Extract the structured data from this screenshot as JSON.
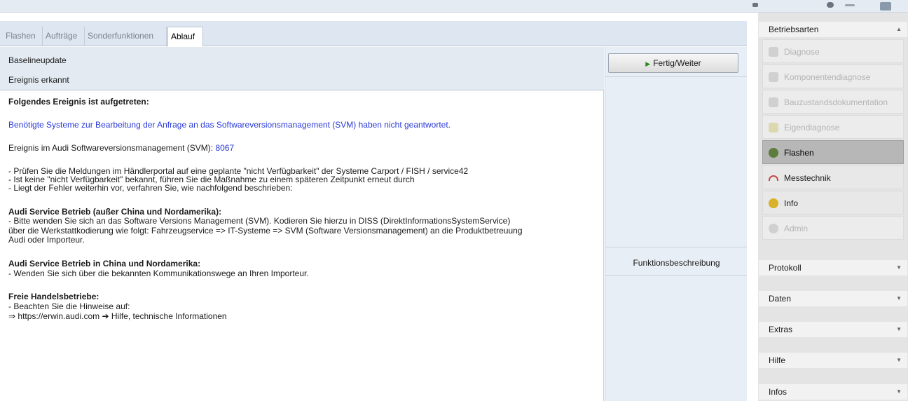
{
  "tabs": [
    {
      "label": "Flashen"
    },
    {
      "label": "Aufträge"
    },
    {
      "label": "Sonderfunktionen"
    },
    {
      "label": "Ablauf"
    }
  ],
  "header": {
    "line1": "Baselineupdate",
    "line2": "Ereignis erkannt"
  },
  "content": {
    "heading": "Folgendes Ereignis ist aufgetreten:",
    "blue_notice": "Benötigte Systeme zur Bearbeitung der Anfrage an das Softwareversionsmanagement (SVM) haben nicht geantwortet.",
    "event_prefix": "Ereignis im Audi Softwareversionsmanagement (SVM): ",
    "event_code": "8067",
    "checks": [
      "- Prüfen Sie die Meldungen im Händlerportal auf eine geplante \"nicht Verfügbarkeit\" der Systeme Carport / FISH / service42",
      "- Ist keine \"nicht Verfügbarkeit\" bekannt, führen Sie die Maßnahme zu einem späteren Zeitpunkt erneut durch",
      "- Liegt der Fehler weiterhin vor, verfahren Sie, wie nachfolgend beschrieben:"
    ],
    "section1_title": "Audi Service Betrieb (außer China und Nordamerika):",
    "section1_lines": [
      "- Bitte wenden Sie sich an das Software Versions Management (SVM). Kodieren Sie hierzu in DISS (DirektInformationsSystemService)",
      "über die Werkstattkodierung wie folgt: Fahrzeugservice => IT-Systeme => SVM (Software Versionsmanagement) an die Produktbetreuung",
      "Audi oder Importeur."
    ],
    "section2_title": "Audi Service Betrieb in China und Nordamerika:",
    "section2_line": "- Wenden Sie sich über die bekannten Kommunikationswege an Ihren Importeur.",
    "section3_title": "Freie Handelsbetriebe:",
    "section3_line": "- Beachten Sie die Hinweise auf:",
    "section3_link": "⇒ https://erwin.audi.com  ➔ Hilfe, technische Informationen"
  },
  "actions": {
    "fertig": "Fertig/Weiter",
    "funktionsbeschreibung": "Funktionsbeschreibung"
  },
  "sidebar": {
    "title": "Betriebsarten",
    "modes": [
      {
        "label": "Diagnose",
        "state": "disabled",
        "icon": "diagnose-icon",
        "color": "#c9c9c9"
      },
      {
        "label": "Komponentendiagnose",
        "state": "disabled",
        "icon": "component-icon",
        "color": "#c9c9c9"
      },
      {
        "label": "Bauzustandsdokumentation",
        "state": "disabled",
        "icon": "document-icon",
        "color": "#c9c9c9"
      },
      {
        "label": "Eigendiagnose",
        "state": "disabled",
        "icon": "self-diagnosis-icon",
        "color": "#d4cfa0"
      },
      {
        "label": "Flashen",
        "state": "active",
        "icon": "flash-icon",
        "color": "#5e7d3d"
      },
      {
        "label": "Messtechnik",
        "state": "normal",
        "icon": "measure-icon",
        "color": "#c44b4b"
      },
      {
        "label": "Info",
        "state": "normal",
        "icon": "info-icon",
        "color": "#d8b32a"
      },
      {
        "label": "Admin",
        "state": "disabled",
        "icon": "admin-icon",
        "color": "#c9c9c9"
      }
    ],
    "sections": [
      {
        "label": "Protokoll"
      },
      {
        "label": "Daten"
      },
      {
        "label": "Extras"
      },
      {
        "label": "Hilfe"
      },
      {
        "label": "Infos"
      }
    ]
  }
}
